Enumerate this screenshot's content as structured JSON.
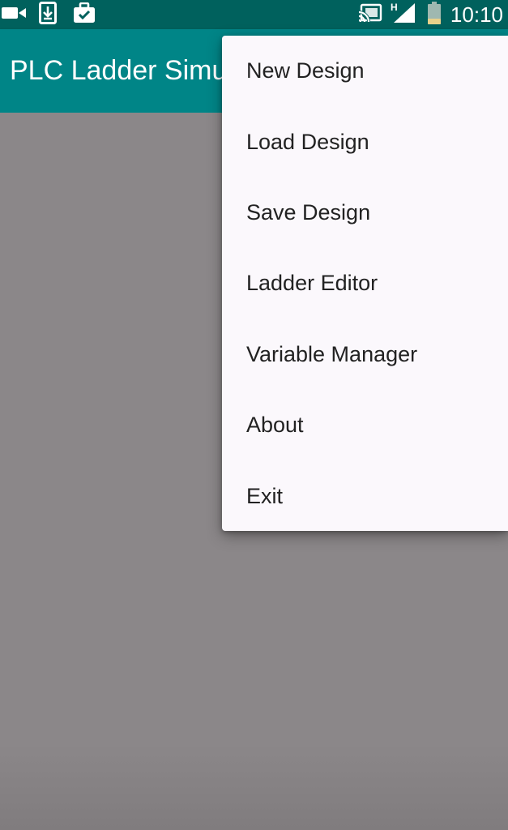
{
  "status_bar": {
    "time": "10:10",
    "network_type": "H",
    "icons": [
      "video-camera-icon",
      "download-icon",
      "briefcase-check-icon",
      "cast-icon",
      "signal-icon",
      "battery-icon"
    ]
  },
  "app_bar": {
    "title": "PLC Ladder Simulator"
  },
  "menu": {
    "items": [
      {
        "label": "New Design"
      },
      {
        "label": "Load Design"
      },
      {
        "label": "Save Design"
      },
      {
        "label": "Ladder Editor"
      },
      {
        "label": "Variable Manager"
      },
      {
        "label": "About"
      },
      {
        "label": "Exit"
      }
    ]
  },
  "colors": {
    "status_bar": "#00615d",
    "app_bar": "#008587",
    "scrim": "#8b8789",
    "menu_bg": "#fbf8fc",
    "menu_text": "#222222"
  }
}
